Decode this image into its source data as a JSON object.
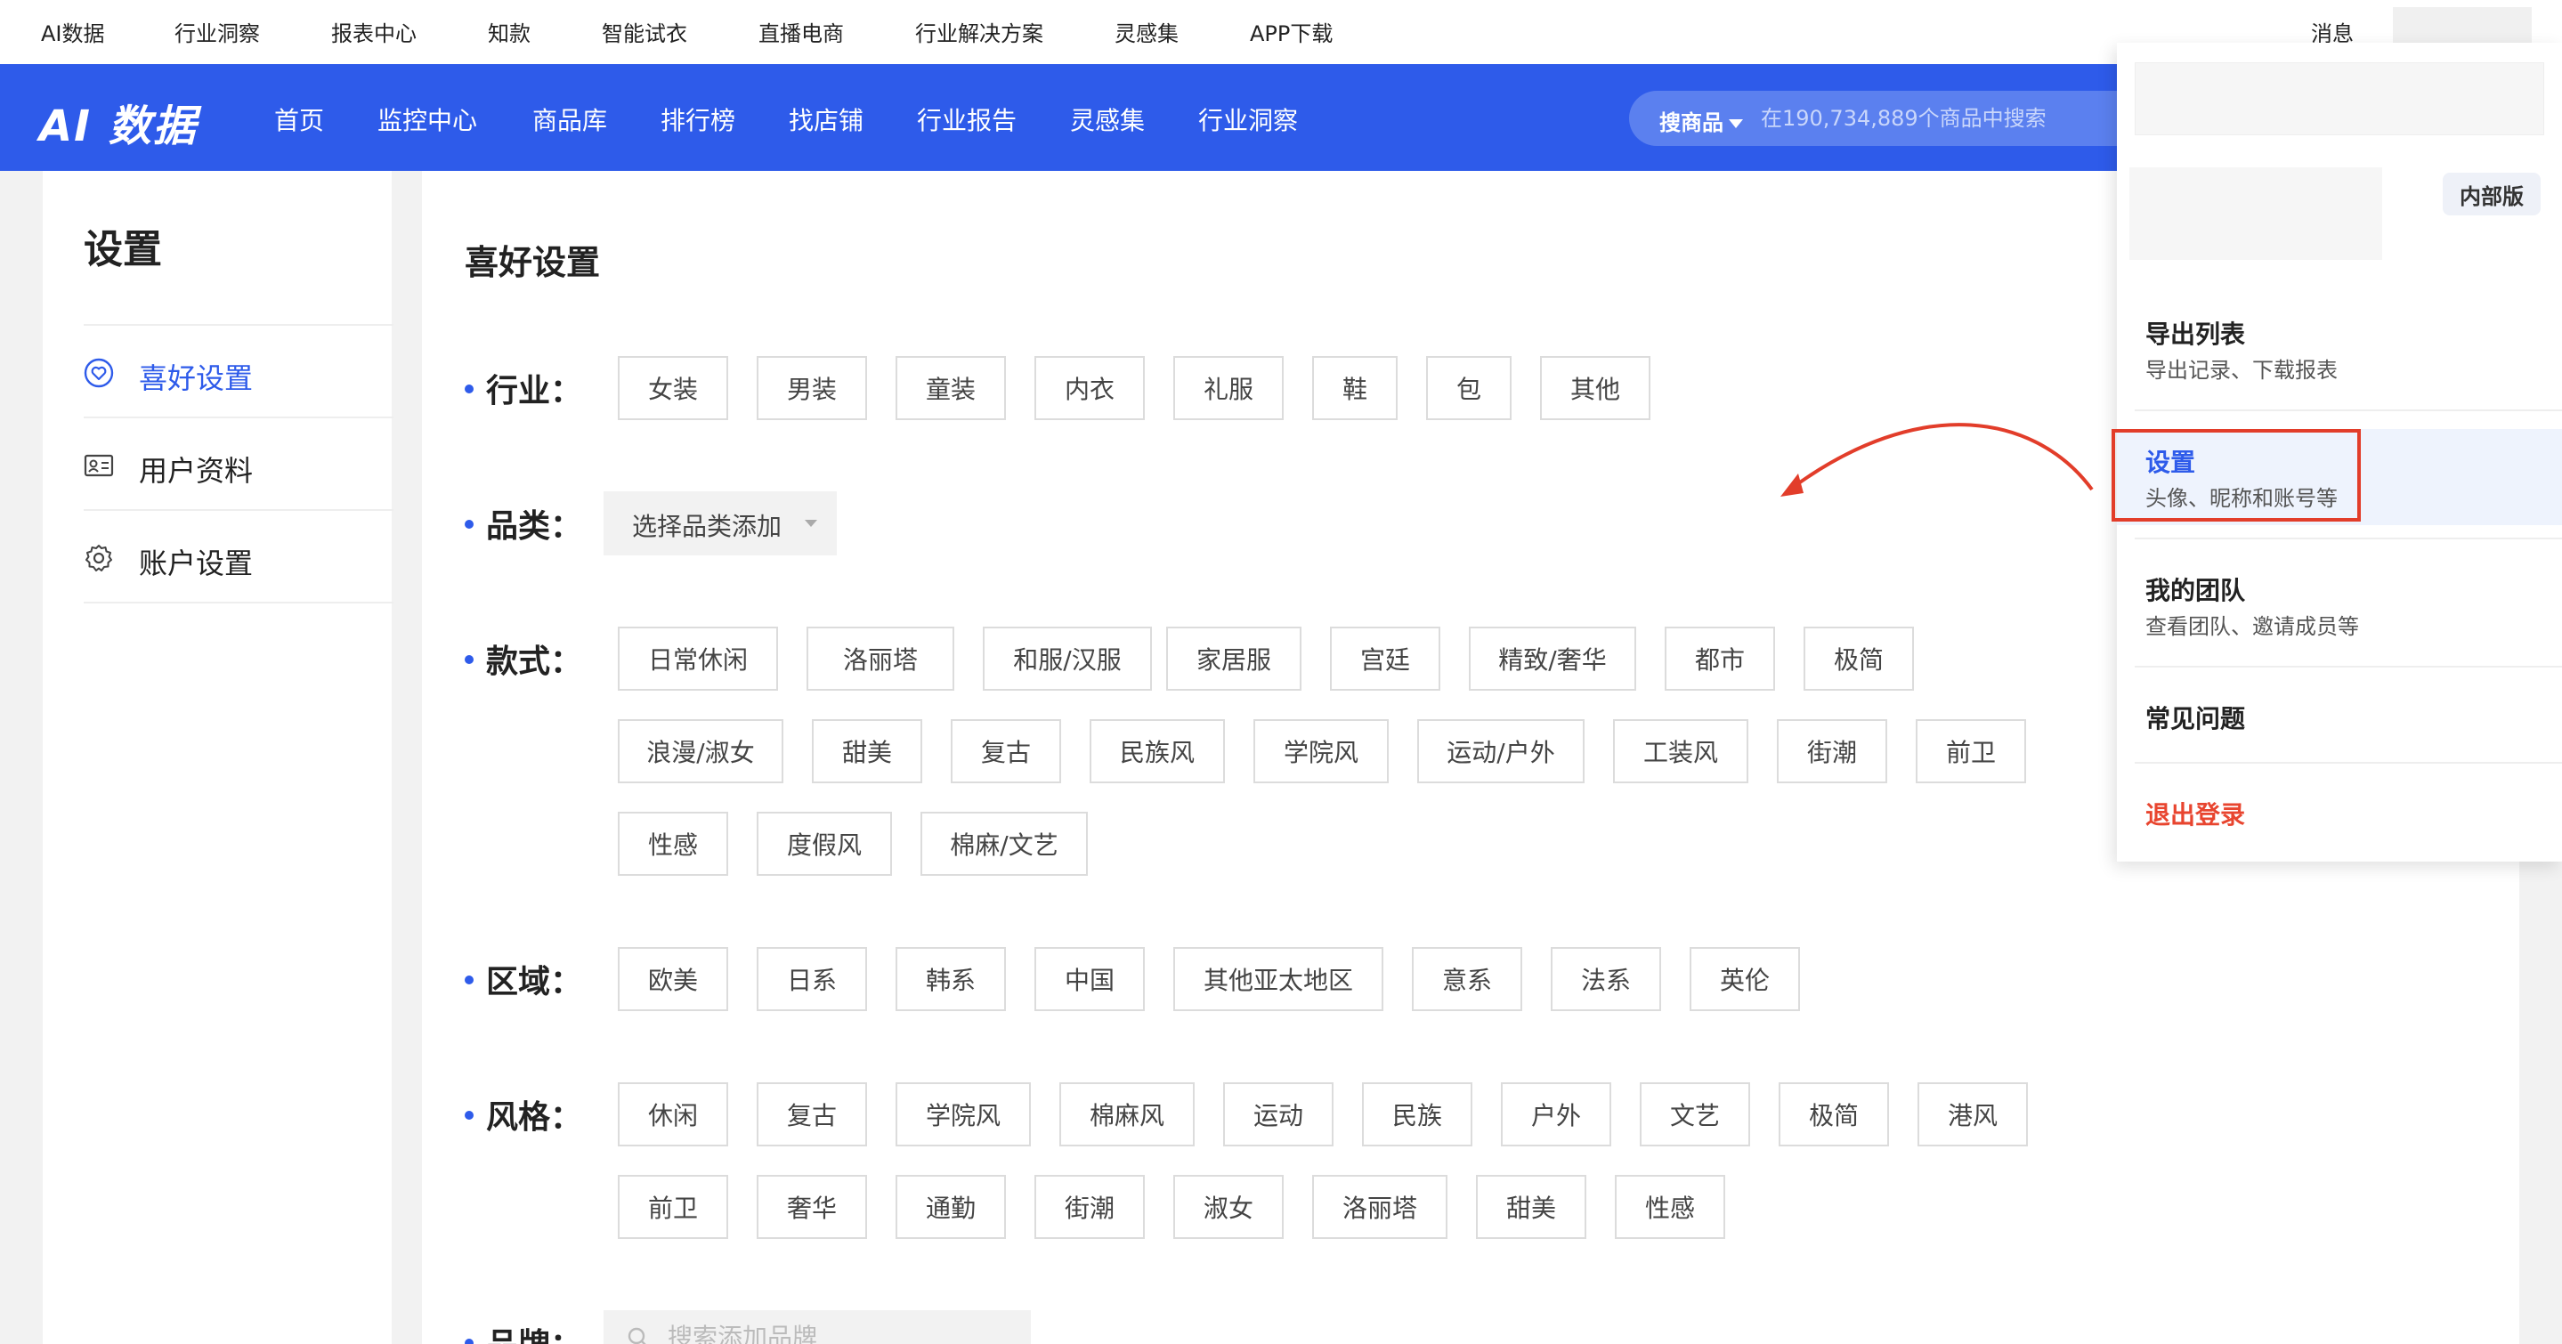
{
  "util_bar": {
    "items": [
      "AI数据",
      "行业洞察",
      "报表中心",
      "知款",
      "智能试衣",
      "直播电商",
      "行业解决方案",
      "灵感集",
      "APP下载"
    ],
    "messages": "消息"
  },
  "nav": {
    "logo": "AI 数据",
    "items": [
      "首页",
      "监控中心",
      "商品库",
      "排行榜",
      "找店铺",
      "行业报告",
      "灵感集",
      "行业洞察"
    ],
    "search_type": "搜商品",
    "search_placeholder": "在190,734,889个商品中搜索"
  },
  "sidebar": {
    "title": "设置",
    "items": [
      {
        "label": "喜好设置",
        "icon": "heart-shield-icon",
        "active": true
      },
      {
        "label": "用户资料",
        "icon": "id-card-icon",
        "active": false
      },
      {
        "label": "账户设置",
        "icon": "gear-icon",
        "active": false
      }
    ]
  },
  "main": {
    "title": "喜好设置",
    "industry": {
      "label": "行业：",
      "tags": [
        "女装",
        "男装",
        "童装",
        "内衣",
        "礼服",
        "鞋",
        "包",
        "其他"
      ]
    },
    "category": {
      "label": "品类：",
      "select_text": "选择品类添加"
    },
    "style_type": {
      "label": "款式：",
      "tags": [
        "日常休闲",
        "洛丽塔",
        "和服/汉服",
        "家居服",
        "宫廷",
        "精致/奢华",
        "都市",
        "极简",
        "浪漫/淑女",
        "甜美",
        "复古",
        "民族风",
        "学院风",
        "运动/户外",
        "工装风",
        "街潮",
        "前卫",
        "性感",
        "度假风",
        "棉麻/文艺"
      ]
    },
    "region": {
      "label": "区域：",
      "tags": [
        "欧美",
        "日系",
        "韩系",
        "中国",
        "其他亚太地区",
        "意系",
        "法系",
        "英伦"
      ]
    },
    "style": {
      "label": "风格：",
      "tags": [
        "休闲",
        "复古",
        "学院风",
        "棉麻风",
        "运动",
        "民族",
        "户外",
        "文艺",
        "极简",
        "港风",
        "前卫",
        "奢华",
        "通勤",
        "街潮",
        "淑女",
        "洛丽塔",
        "甜美",
        "性感"
      ]
    },
    "brand": {
      "label": "品牌：",
      "placeholder": "搜索添加品牌"
    }
  },
  "dropdown": {
    "badge": "内部版",
    "items": [
      {
        "title": "导出列表",
        "sub": "导出记录、下载报表"
      },
      {
        "title": "设置",
        "sub": "头像、昵称和账号等"
      },
      {
        "title": "我的团队",
        "sub": "查看团队、邀请成员等"
      },
      {
        "title": "常见问题",
        "sub": ""
      },
      {
        "title": "退出登录",
        "sub": ""
      }
    ]
  },
  "colors": {
    "brand_blue": "#2e5bea",
    "highlight_red": "#e23d2a",
    "logout_red": "#e8452f"
  }
}
